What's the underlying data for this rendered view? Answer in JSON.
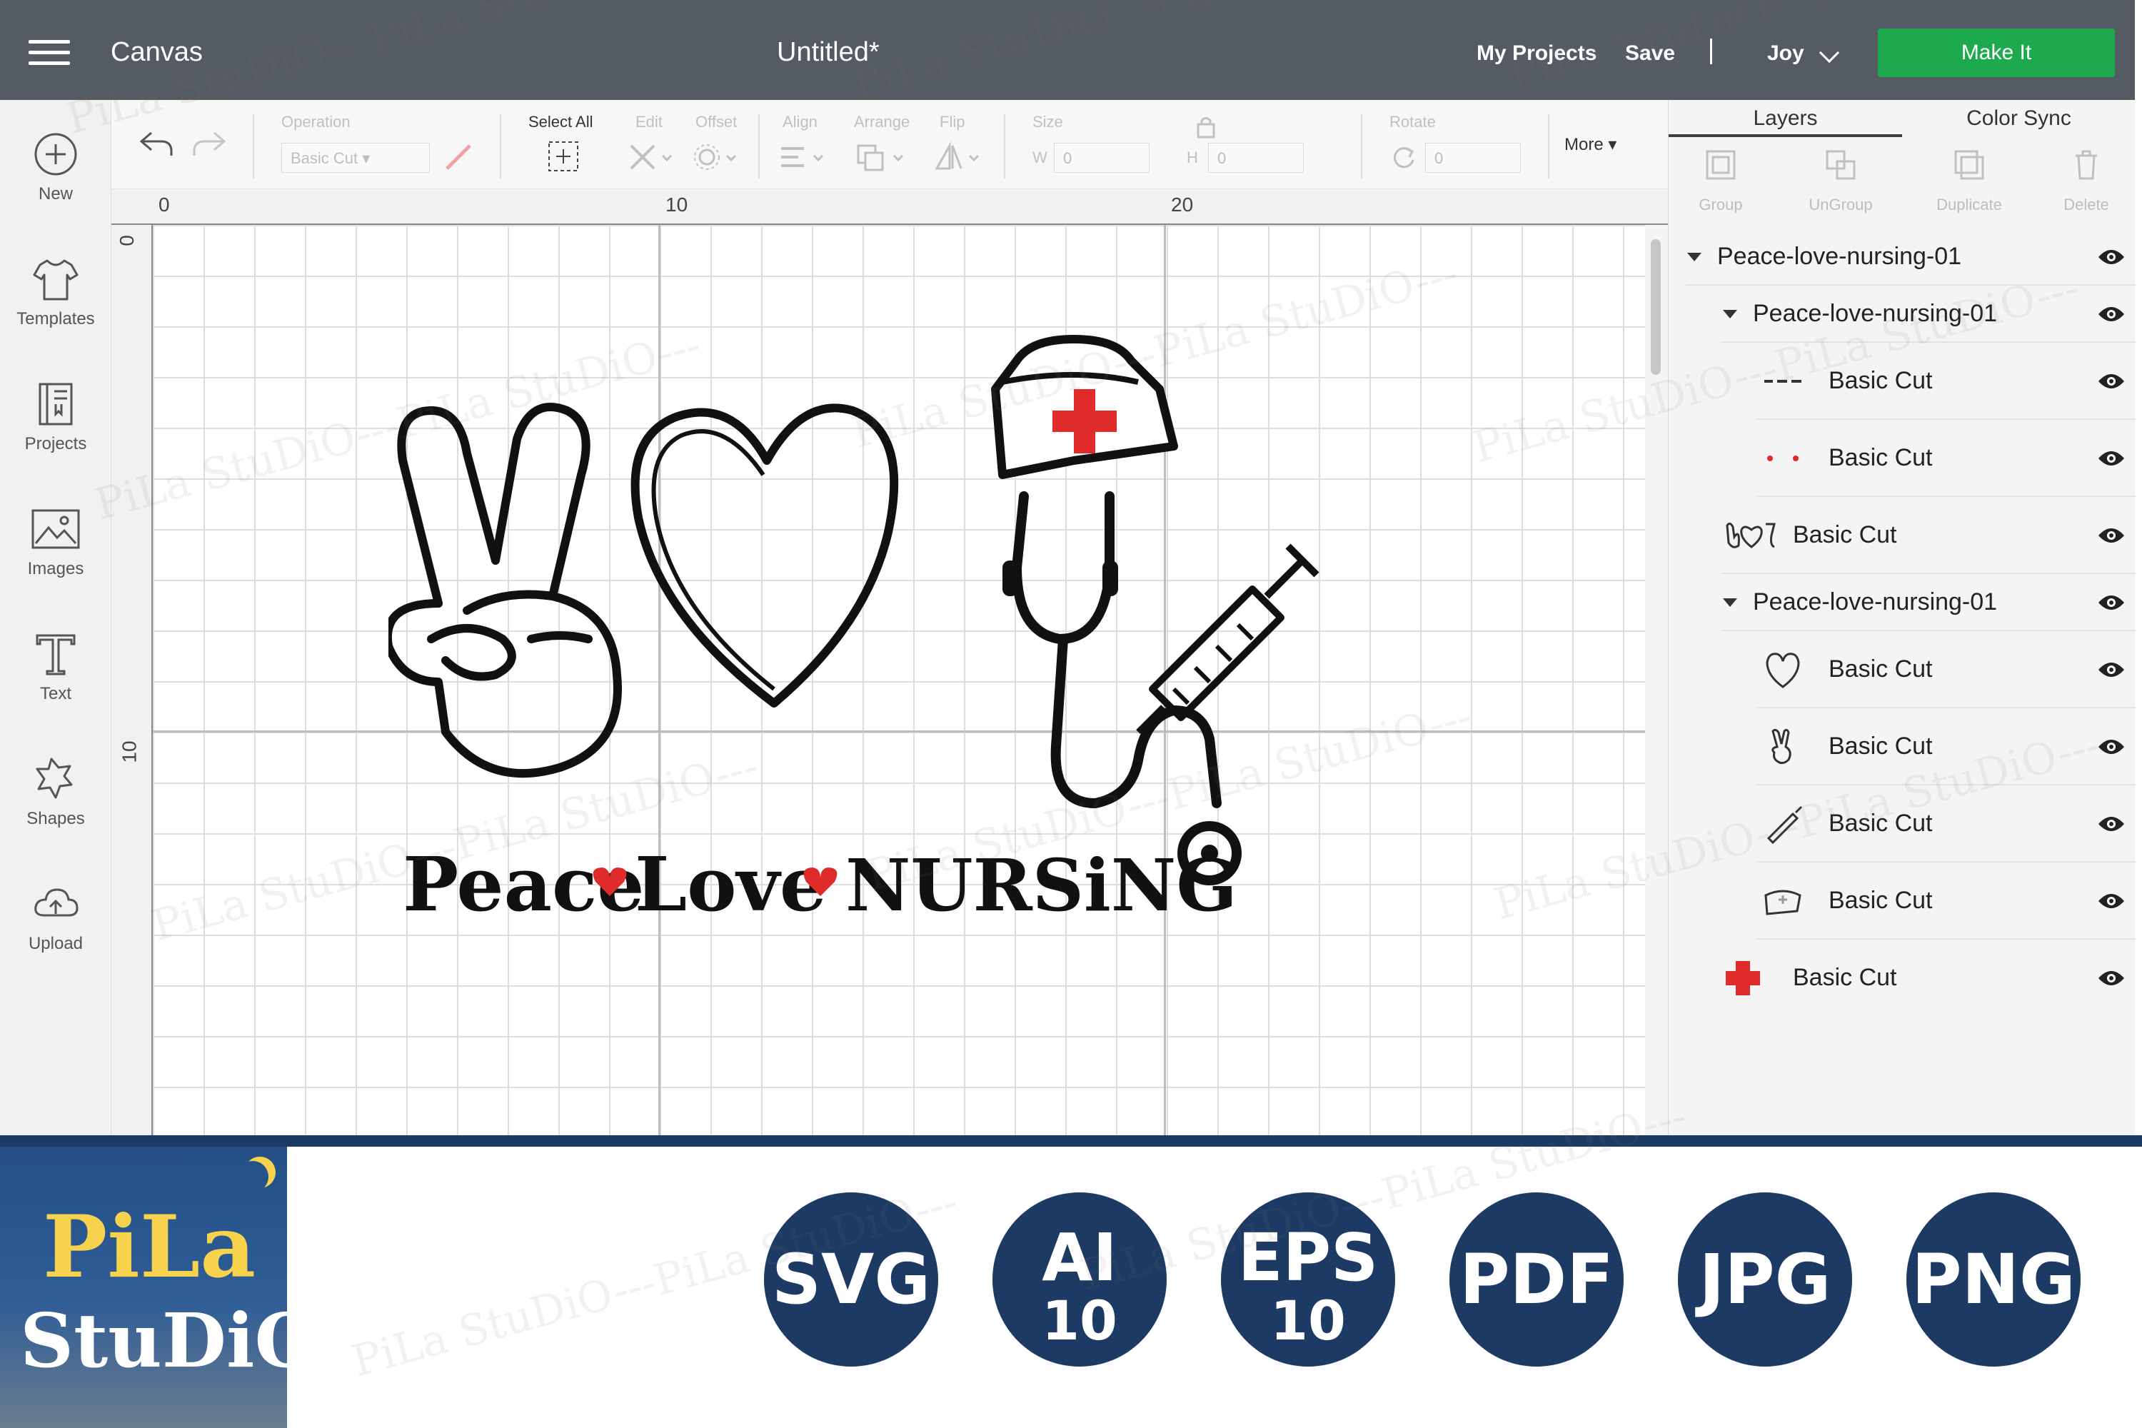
{
  "header": {
    "app_title": "Canvas",
    "doc_title": "Untitled*",
    "my_projects": "My Projects",
    "save": "Save",
    "user": "Joy",
    "make_it": "Make It"
  },
  "sidebar": {
    "items": [
      {
        "label": "New",
        "icon": "plus-circle-icon"
      },
      {
        "label": "Templates",
        "icon": "tshirt-icon"
      },
      {
        "label": "Projects",
        "icon": "projects-icon"
      },
      {
        "label": "Images",
        "icon": "image-icon"
      },
      {
        "label": "Text",
        "icon": "text-icon"
      },
      {
        "label": "Shapes",
        "icon": "shapes-icon"
      },
      {
        "label": "Upload",
        "icon": "upload-icon"
      }
    ]
  },
  "toolbar": {
    "operation_label": "Operation",
    "operation_value": "Basic Cut",
    "select_all": "Select All",
    "edit": "Edit",
    "offset": "Offset",
    "align": "Align",
    "arrange": "Arrange",
    "flip": "Flip",
    "size": "Size",
    "w_label": "W",
    "w_value": "0",
    "h_label": "H",
    "h_value": "0",
    "rotate": "Rotate",
    "rotate_value": "0",
    "more": "More"
  },
  "rulers": {
    "top": [
      "0",
      "10",
      "20"
    ],
    "left": [
      "0",
      "10"
    ]
  },
  "design": {
    "text_peace": "Peace",
    "text_love": "Love",
    "text_nursing": "NURSiNG"
  },
  "panel": {
    "tabs": [
      "Layers",
      "Color Sync"
    ],
    "tools": [
      "Group",
      "UnGroup",
      "Duplicate",
      "Delete"
    ],
    "layers": [
      {
        "name": "Peace-love-nursing-01",
        "type": "group"
      },
      {
        "name": "Peace-love-nursing-01",
        "type": "group"
      },
      {
        "name": "Basic Cut",
        "type": "layer",
        "thumb": "dashes"
      },
      {
        "name": "Basic Cut",
        "type": "layer",
        "thumb": "dots"
      },
      {
        "name": "Basic Cut",
        "type": "layer",
        "thumb": "full-design"
      },
      {
        "name": "Peace-love-nursing-01",
        "type": "group"
      },
      {
        "name": "Basic Cut",
        "type": "layer",
        "thumb": "heart"
      },
      {
        "name": "Basic Cut",
        "type": "layer",
        "thumb": "peace-hand"
      },
      {
        "name": "Basic Cut",
        "type": "layer",
        "thumb": "syringe"
      },
      {
        "name": "Basic Cut",
        "type": "layer",
        "thumb": "nurse-cap"
      },
      {
        "name": "Basic Cut",
        "type": "layer",
        "thumb": "red-cross"
      }
    ]
  },
  "branding": {
    "logo_line1": "PiLa",
    "logo_line2": "StuDiO",
    "watermark": "PiLa StuDiO---PiLa StuDiO---"
  },
  "formats": [
    {
      "line1": "SVG",
      "line2": ""
    },
    {
      "line1": "AI",
      "line2": "10"
    },
    {
      "line1": "EPS",
      "line2": "10"
    },
    {
      "line1": "PDF",
      "line2": ""
    },
    {
      "line1": "JPG",
      "line2": ""
    },
    {
      "line1": "PNG",
      "line2": ""
    }
  ],
  "colors": {
    "topbar": "#555b62",
    "make_it": "#1daa4f",
    "navy": "#1c3a63",
    "logo_yellow": "#f7d24c",
    "accent_red": "#e02b2b"
  }
}
